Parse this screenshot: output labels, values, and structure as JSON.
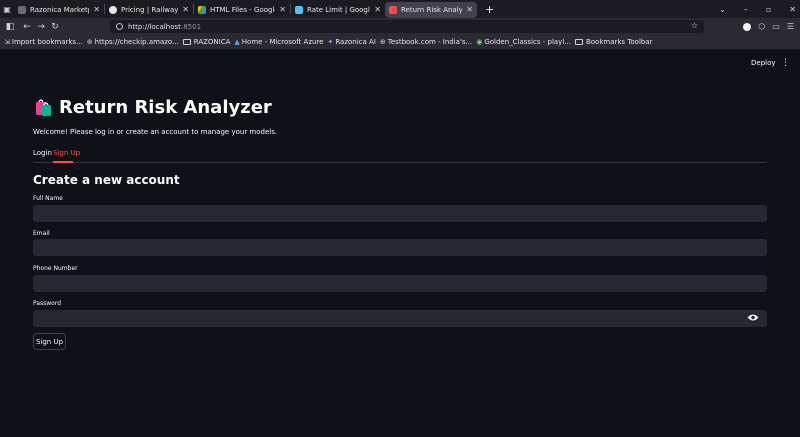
{
  "browser": {
    "tabs": [
      {
        "title": "Razonica Marketplace Intelli",
        "icon": "page-icon",
        "color": "#6b6b75"
      },
      {
        "title": "Pricing | Railway",
        "icon": "railway-icon",
        "color": "#e8e8ea"
      },
      {
        "title": "HTML Files - Google Drive",
        "icon": "drive-icon",
        "color": "#34a853"
      },
      {
        "title": "Rate Limit | Google AI St",
        "icon": "ai-studio-icon",
        "color": "#4fc3f7"
      },
      {
        "title": "Return Risk Analyzer",
        "icon": "streamlit-icon",
        "color": "#ff4b4b"
      }
    ],
    "url": {
      "host": "http://localhost",
      "port": ":8501"
    },
    "bookmarks": [
      {
        "label": "Import bookmarks...",
        "icon": "import-icon"
      },
      {
        "label": "https://checkip.amazo...",
        "icon": "globe-icon"
      },
      {
        "label": "RAZONICA",
        "icon": "folder-icon"
      },
      {
        "label": "Home - Microsoft Azure",
        "icon": "azure-icon"
      },
      {
        "label": "Razonica AI",
        "icon": "razonica-ai-icon"
      },
      {
        "label": "Testbook.com - India's...",
        "icon": "globe-icon"
      },
      {
        "label": "Golden_Classics - playl...",
        "icon": "globe-icon"
      },
      {
        "label": "Bookmarks Toolbar",
        "icon": "folder-icon"
      }
    ]
  },
  "app": {
    "deploy_label": "Deploy",
    "menu_icon": "⋮",
    "title": "Return Risk Analyzer",
    "welcome": "Welcome! Please log in or create an account to manage your models.",
    "tabs": {
      "login": "Login",
      "signup": "Sign Up"
    },
    "form": {
      "heading": "Create a new account",
      "full_name_label": "Full Name",
      "email_label": "Email",
      "phone_label": "Phone Number",
      "password_label": "Password",
      "submit_label": "Sign Up"
    },
    "accent_color": "#ff4b4b"
  }
}
